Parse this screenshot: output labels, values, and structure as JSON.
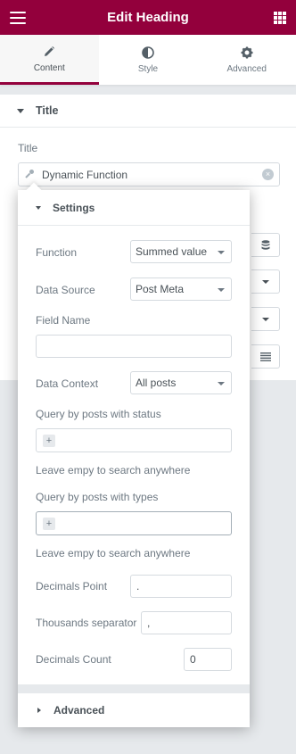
{
  "header": {
    "title": "Edit Heading"
  },
  "tabs": [
    {
      "label": "Content",
      "icon": "pencil-icon",
      "active": true
    },
    {
      "label": "Style",
      "icon": "half-circle-icon",
      "active": false
    },
    {
      "label": "Advanced",
      "icon": "gear-icon",
      "active": false
    }
  ],
  "section": {
    "title": "Title",
    "field_label": "Title",
    "dynamic_value": "Dynamic Function",
    "clear_glyph": "×"
  },
  "popover": {
    "title": "Settings",
    "function": {
      "label": "Function",
      "value": "Summed value"
    },
    "data_source": {
      "label": "Data Source",
      "value": "Post Meta"
    },
    "field_name": {
      "label": "Field Name",
      "value": ""
    },
    "data_context": {
      "label": "Data Context",
      "value": "All posts"
    },
    "status": {
      "label": "Query by posts with status",
      "hint": "Leave empy to search anywhere",
      "add": "+"
    },
    "types": {
      "label": "Query by posts with types",
      "hint": "Leave empy to search anywhere",
      "add": "+"
    },
    "decimals_point": {
      "label": "Decimals Point",
      "value": "."
    },
    "thousands_separator": {
      "label": "Thousands separator",
      "value": ","
    },
    "decimals_count": {
      "label": "Decimals Count",
      "value": "0"
    },
    "advanced_label": "Advanced"
  },
  "colors": {
    "brand": "#93003c",
    "panel_bg": "#e6e9ec",
    "text": "#6d7882",
    "text_dark": "#495157"
  }
}
